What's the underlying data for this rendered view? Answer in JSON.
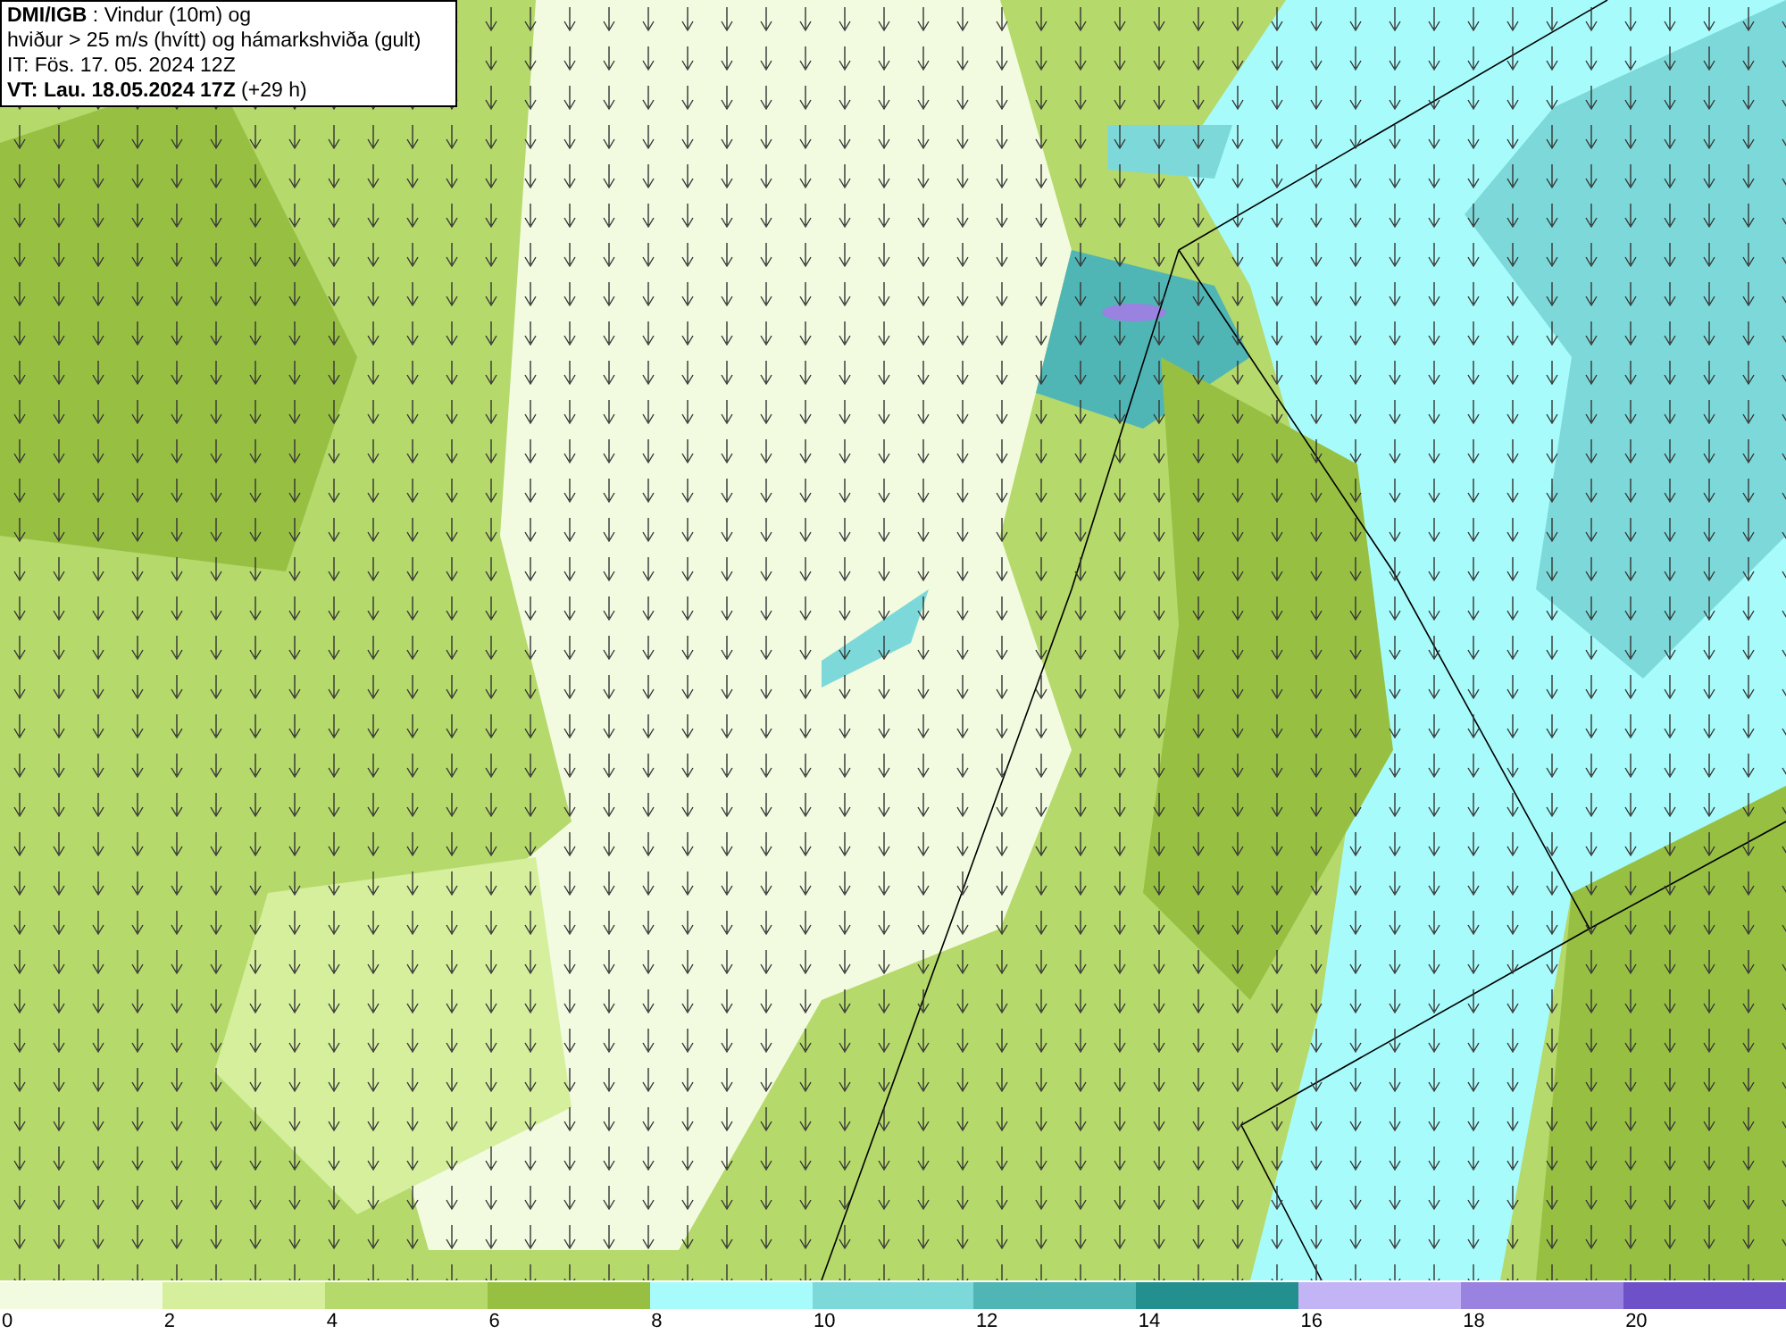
{
  "header": {
    "lines": [
      "**DMI/IGB** : Vindur (10m) og",
      "hviður > 25 m/s (hvítt) og hámarkshviða (gult)",
      "IT: Fös. 17. 05. 2024 12Z",
      "**VT: Lau. 18.05.2024 17Z** (+29 h)"
    ]
  },
  "legend": {
    "swatches": [
      {
        "color": "#f2fbe0"
      },
      {
        "color": "#d5ef9d"
      },
      {
        "color": "#b5d96b"
      },
      {
        "color": "#97c043"
      },
      {
        "color": "#a8fbfb"
      },
      {
        "color": "#7dd9d9"
      },
      {
        "color": "#50b5b5"
      },
      {
        "color": "#238f8f"
      },
      {
        "color": "#c3b4f5"
      },
      {
        "color": "#9982e0"
      },
      {
        "color": "#6e50c8"
      }
    ],
    "ticks": [
      "0",
      "2",
      "4",
      "6",
      "8",
      "10",
      "12",
      "14",
      "16",
      "18",
      "20"
    ]
  }
}
